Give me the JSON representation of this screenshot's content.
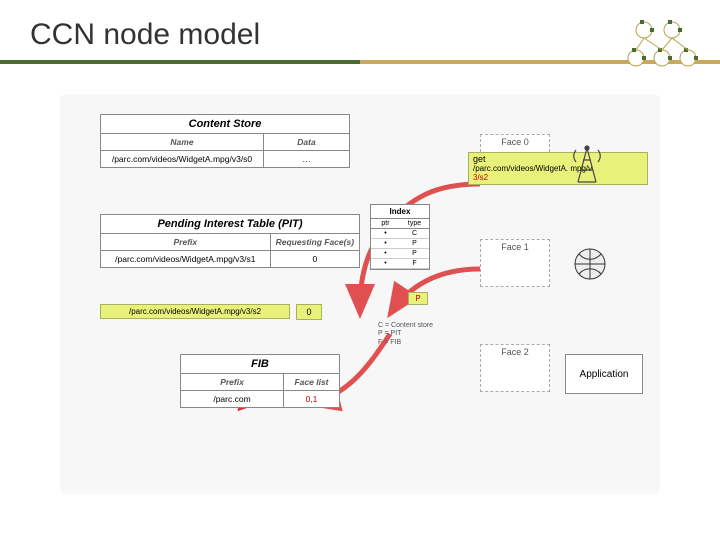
{
  "title": "CCN node model",
  "contentStore": {
    "heading": "Content Store",
    "col1": "Name",
    "col2": "Data",
    "row1_name": "/parc.com/videos/WidgetA.mpg/v3/s0",
    "row1_data": "…"
  },
  "pit": {
    "heading": "Pending Interest Table (PIT)",
    "col1": "Prefix",
    "col2": "Requesting Face(s)",
    "row1_prefix": "/parc.com/videos/WidgetA.mpg/v3/s1",
    "row1_faces": "0",
    "row2_prefix": "/parc.com/videos/WidgetA.mpg/v3/s2",
    "row2_faces": "0"
  },
  "fib": {
    "heading": "FIB",
    "col1": "Prefix",
    "col2": "Face list",
    "row1_prefix": "/parc.com",
    "row1_faces": "0,1"
  },
  "index": {
    "heading": "Index",
    "hcol1": "ptr",
    "hcol2": "type",
    "rows": [
      {
        "ptr": "",
        "type": "C"
      },
      {
        "ptr": "",
        "type": "P"
      },
      {
        "ptr": "",
        "type": "P"
      },
      {
        "ptr": "",
        "type": "F"
      }
    ],
    "legend": "C = Content store\nP = PIT\nF = FIB"
  },
  "faces": {
    "f0": "Face 0",
    "f1": "Face 1",
    "f2": "Face 2"
  },
  "application": "Application",
  "request": {
    "line1": "get",
    "line2": "/parc.com/videos/WidgetA.mpg/v3/s2",
    "line2_short": "/parc.com/videos/WidgetA. mpg/v",
    "line3": "3/s2"
  },
  "index_extra_P": "P"
}
